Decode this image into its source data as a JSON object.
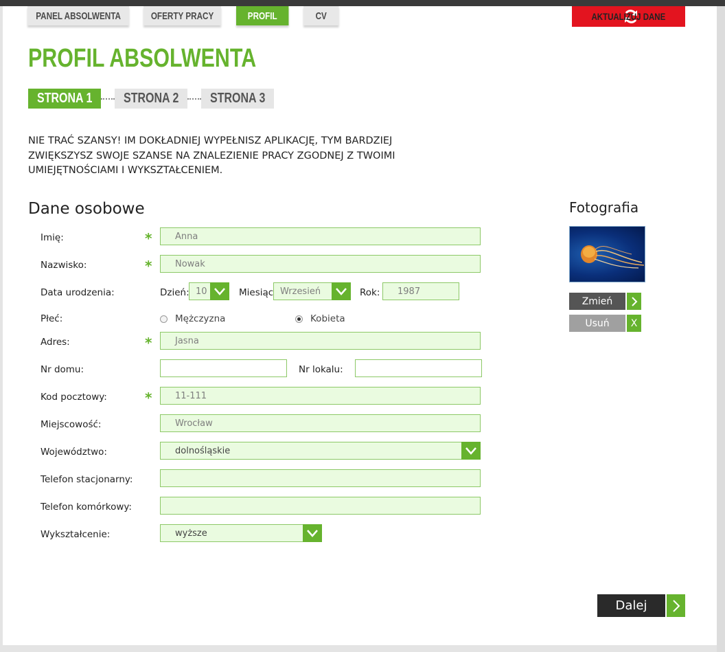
{
  "nav": {
    "tabs": [
      {
        "label": "PANEL ABSOLWENTA",
        "active": false
      },
      {
        "label": "OFERTY PRACY",
        "active": false
      },
      {
        "label": "PROFIL",
        "active": true
      },
      {
        "label": "CV",
        "active": false
      }
    ],
    "update_button": {
      "label": "AKTUALIZUJ DANE",
      "icon": "refresh-icon"
    }
  },
  "page_title": "PROFIL ABSOLWENTA",
  "steps": [
    {
      "label": "STRONA 1",
      "active": true
    },
    {
      "label": "STRONA 2",
      "active": false
    },
    {
      "label": "STRONA 3",
      "active": false
    }
  ],
  "intro": "NIE TRAĆ SZANSY! IM DOKŁADNIEJ WYPEŁNISZ APLIKACJĘ, TYM BARDZIEJ ZWIĘKSZYSZ SWOJE SZANSE NA ZNALEZIENIE PRACY ZGODNEJ Z TWOIMI UMIEJĘTNOŚCIAMI I WYKSZTAŁCENIEM.",
  "personal": {
    "section_title": "Dane osobowe",
    "required_mark": "*",
    "first_name": {
      "label": "Imię:",
      "value": "Anna"
    },
    "last_name": {
      "label": "Nazwisko:",
      "value": "Nowak"
    },
    "birth_date": {
      "label": "Data urodzenia:",
      "day_label": "Dzień:",
      "day_value": "10",
      "month_label": "Miesiąc:",
      "month_value": "Wrzesień",
      "year_label": "Rok:",
      "year_value": "1987"
    },
    "gender": {
      "label": "Płeć:",
      "options": [
        "Mężczyzna",
        "Kobieta"
      ],
      "selected": "Kobieta"
    },
    "address": {
      "label": "Adres:",
      "value": "Jasna"
    },
    "house_no": {
      "label": "Nr domu:",
      "value": ""
    },
    "apartment_no": {
      "label": "Nr lokalu:",
      "value": ""
    },
    "postal_code": {
      "label": "Kod pocztowy:",
      "value": "11-111"
    },
    "city": {
      "label": "Miejscowość:",
      "value": "Wrocław"
    },
    "voivodeship": {
      "label": "Województwo:",
      "value": "dolnośląskie"
    },
    "landline": {
      "label": "Telefon stacjonarny:",
      "value": ""
    },
    "mobile": {
      "label": "Telefon komórkowy:",
      "value": ""
    },
    "education": {
      "label": "Wykształcenie:",
      "value": "wyższe"
    }
  },
  "photo": {
    "section_title": "Fotografia",
    "change_label": "Zmień",
    "change_icon": "chevron-right-icon",
    "remove_label": "Usuń",
    "remove_icon_text": "X"
  },
  "next_button": {
    "label": "Dalej"
  },
  "colors": {
    "accent": "#66b32e",
    "alert": "#e3141f",
    "field_bg": "#eafbe0",
    "field_border": "#8cc866",
    "dark_button": "#2a2a2a"
  }
}
